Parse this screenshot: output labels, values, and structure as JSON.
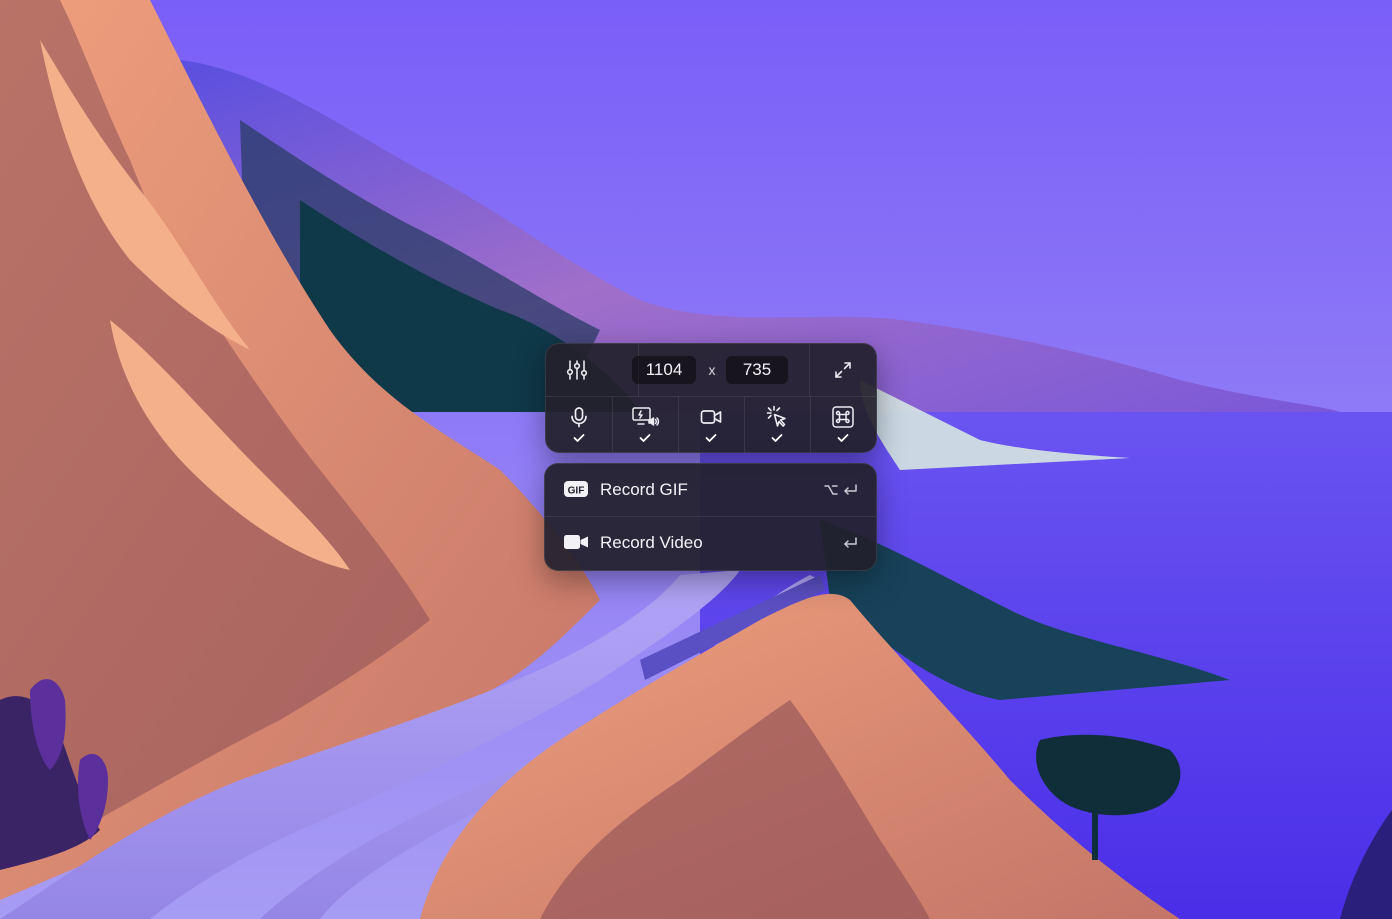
{
  "capture_toolbar": {
    "width_value": "1104",
    "separator": "x",
    "height_value": "735",
    "tools": [
      {
        "icon": "microphone-icon",
        "checked": true
      },
      {
        "icon": "system-audio-icon",
        "checked": true
      },
      {
        "icon": "camera-icon",
        "checked": true
      },
      {
        "icon": "cursor-highlight-icon",
        "checked": true
      },
      {
        "icon": "keystrokes-icon",
        "checked": true
      }
    ]
  },
  "record_menu": {
    "items": [
      {
        "label": "Record GIF",
        "icon": "gif-icon",
        "shortcut_keys": [
          "option-key-icon",
          "return-key-icon"
        ]
      },
      {
        "label": "Record Video",
        "icon": "video-camera-icon",
        "shortcut_keys": [
          "return-key-icon"
        ]
      }
    ]
  },
  "colors": {
    "sky_top": "#7a5ef8",
    "sky_bottom": "#9d90f6",
    "sea": "#5a40ef",
    "cliff_orange": "#eda07c",
    "cliff_brown": "#8a4f56",
    "road": "#a89af2",
    "panel_bg": "#22202c"
  }
}
